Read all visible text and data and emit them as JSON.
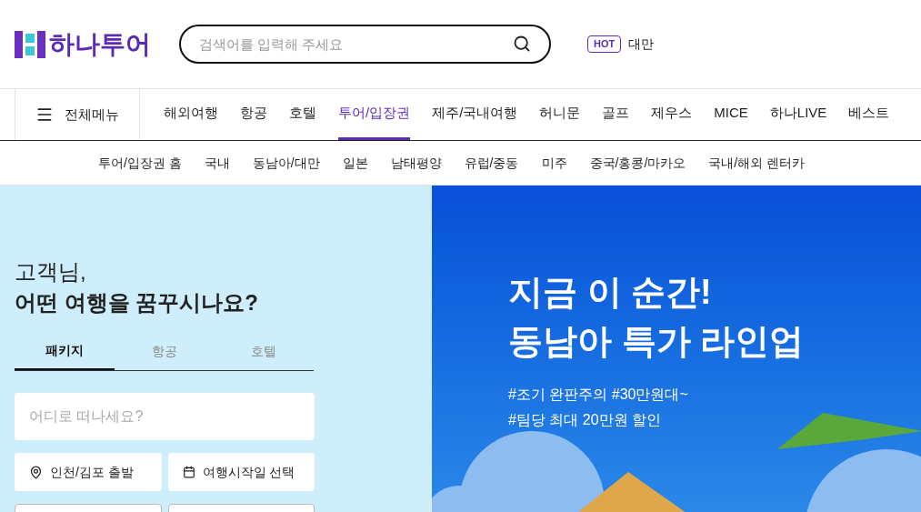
{
  "header": {
    "logo": "하나투어",
    "search": {
      "placeholder": "검색어를 입력해 주세요"
    },
    "hot": {
      "badge": "HOT",
      "keyword": "대만"
    }
  },
  "nav": {
    "menu_button": "전체메뉴",
    "items": [
      {
        "label": "해외여행",
        "selected": false
      },
      {
        "label": "항공",
        "selected": false
      },
      {
        "label": "호텔",
        "selected": false
      },
      {
        "label": "투어/입장권",
        "selected": true
      },
      {
        "label": "제주/국내여행",
        "selected": false
      },
      {
        "label": "허니문",
        "selected": false
      },
      {
        "label": "골프",
        "selected": false
      },
      {
        "label": "제우스",
        "selected": false
      },
      {
        "label": "MICE",
        "selected": false
      },
      {
        "label": "하나LIVE",
        "selected": false
      },
      {
        "label": "베스트",
        "selected": false
      }
    ]
  },
  "subnav": [
    "투어/입장권 홈",
    "국내",
    "동남아/대만",
    "일본",
    "남태평양",
    "유럽/중동",
    "미주",
    "중국/홍콩/마카오",
    "국내/해외 렌터카"
  ],
  "search_panel": {
    "greeting": "고객님,",
    "question": "어떤 여행을 꿈꾸시나요?",
    "tabs": [
      {
        "label": "패키지",
        "selected": true
      },
      {
        "label": "항공",
        "selected": false
      },
      {
        "label": "호텔",
        "selected": false
      }
    ],
    "destination": {
      "placeholder": "어디로 떠나세요?"
    },
    "departure": "인천/김포 출발",
    "date": "여행시작일 선택"
  },
  "banner": {
    "title_lines": [
      "지금 이 순간!",
      "동남아 특가 라인업"
    ],
    "tags": [
      "#조기 완판주의 #30만원대~",
      "#팀당 최대 20만원 할인"
    ]
  }
}
